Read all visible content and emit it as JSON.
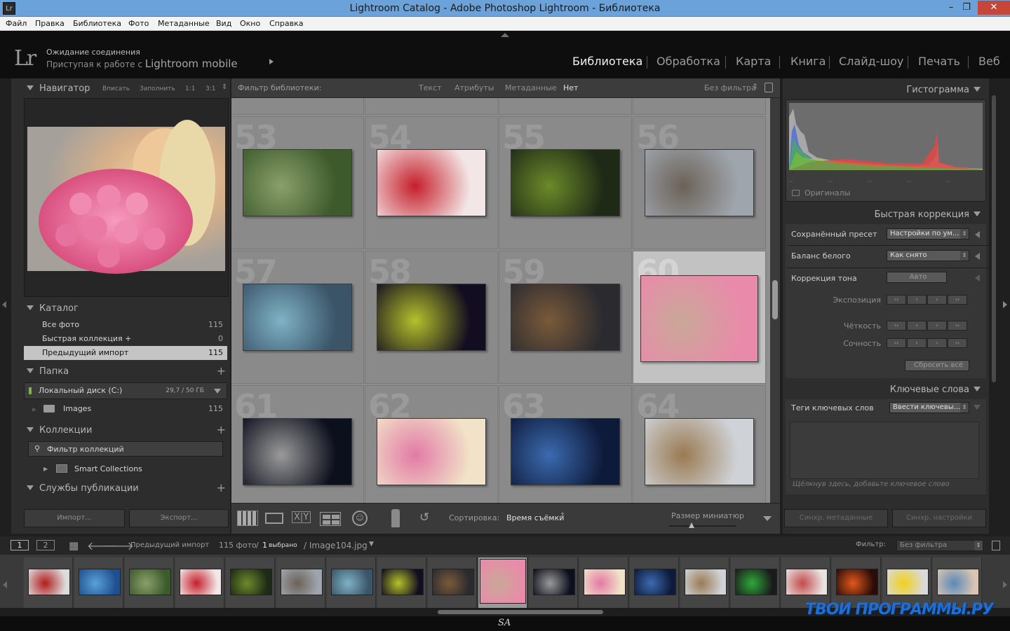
{
  "window": {
    "title": "Lightroom Catalog - Adobe Photoshop Lightroom - Библиотека",
    "app_icon": "Lr",
    "minimize": "–",
    "maximize": "❐",
    "close": "✕"
  },
  "menu": [
    "Файл",
    "Правка",
    "Библиотека",
    "Фото",
    "Метаданные",
    "Вид",
    "Окно",
    "Справка"
  ],
  "identity": {
    "logo": "Lr",
    "status_line1": "Ожидание соединения",
    "status_line2_prefix": "Приступая к работе с",
    "status_line2_brand": "Lightroom mobile"
  },
  "modules": [
    {
      "label": "Библиотека",
      "active": true
    },
    {
      "label": "Обработка",
      "active": false
    },
    {
      "label": "Карта",
      "active": false
    },
    {
      "label": "Книга",
      "active": false
    },
    {
      "label": "Слайд-шоу",
      "active": false
    },
    {
      "label": "Печать",
      "active": false
    },
    {
      "label": "Веб",
      "active": false
    }
  ],
  "navigator": {
    "title": "Навигатор",
    "options": [
      "Вписать",
      "Заполнить",
      "1:1",
      "3:1"
    ]
  },
  "catalog": {
    "title": "Каталог",
    "items": [
      {
        "label": "Все фото",
        "count": "115",
        "selected": false
      },
      {
        "label": "Быстрая коллекция +",
        "count": "0",
        "selected": false
      },
      {
        "label": "Предыдущий импорт",
        "count": "115",
        "selected": true
      }
    ]
  },
  "folders": {
    "title": "Папка",
    "disk_label": "Локальный диск (C:)",
    "disk_usage": "29,7 / 50 ГБ",
    "folder_label": "Images",
    "folder_count": "115"
  },
  "collections": {
    "title": "Коллекции",
    "filter_placeholder": "Фильтр коллекций",
    "smart": "Smart Collections"
  },
  "publish": {
    "title": "Службы публикации"
  },
  "left_buttons": {
    "import": "Импорт...",
    "export": "Экспорт..."
  },
  "filter_bar": {
    "label": "Фильтр библиотеки:",
    "tabs": [
      "Текст",
      "Атрибуты",
      "Метаданные",
      "Нет"
    ],
    "preset": "Без фильтра"
  },
  "grid": {
    "cells": [
      {
        "num": "53",
        "c1": "#3d5a2c",
        "c2": "#8aa06a",
        "selected": false
      },
      {
        "num": "54",
        "c1": "#f3e6e6",
        "c2": "#c51f2b",
        "selected": false
      },
      {
        "num": "55",
        "c1": "#1e2a16",
        "c2": "#6c8a2a",
        "selected": false
      },
      {
        "num": "56",
        "c1": "#9fa5ad",
        "c2": "#6b6258",
        "selected": false
      },
      {
        "num": "57",
        "c1": "#3b5468",
        "c2": "#7fb2c6",
        "selected": false
      },
      {
        "num": "58",
        "c1": "#120d20",
        "c2": "#b6c12a",
        "selected": false
      },
      {
        "num": "59",
        "c1": "#2a2a2f",
        "c2": "#7a5a3a",
        "selected": false
      },
      {
        "num": "60",
        "c1": "#e98aaa",
        "c2": "#caa898",
        "selected": true
      },
      {
        "num": "61",
        "c1": "#0c0f1c",
        "c2": "#9a9a9a",
        "selected": false
      },
      {
        "num": "62",
        "c1": "#f2e2c8",
        "c2": "#e27aa6",
        "selected": false
      },
      {
        "num": "63",
        "c1": "#0e1a3a",
        "c2": "#3b6bb0",
        "selected": false
      },
      {
        "num": "64",
        "c1": "#cfd3d8",
        "c2": "#9a7a52",
        "selected": false
      }
    ]
  },
  "toolbar": {
    "sort_label": "Сортировка:",
    "sort_value": "Время съёмки",
    "thumb_size_label": "Размер миниатюр"
  },
  "histogram": {
    "title": "Гистограмма",
    "originals": "Оригиналы"
  },
  "quick_develop": {
    "title": "Быстрая коррекция",
    "saved_preset_label": "Сохранённый пресет",
    "saved_preset_value": "Настройки по ум...",
    "wb_label": "Баланс белого",
    "wb_value": "Как снято",
    "tone_label": "Коррекция тона",
    "auto_btn": "Авто",
    "exposure": "Экспозиция",
    "clarity": "Чёткость",
    "vibrance": "Сочность",
    "reset": "Сбросить всё"
  },
  "keywords": {
    "title": "Ключевые слова",
    "tags_label": "Теги ключевых слов",
    "tags_value": "Ввести ключевы...",
    "hint": "Щёлкнув здесь, добавьте ключевое слово"
  },
  "right_buttons": {
    "sync_meta": "Синхр. метаданные",
    "sync_settings": "Синхр. настройки"
  },
  "filmstrip": {
    "screen1": "1",
    "screen2": "2",
    "source": "Предыдущий импорт",
    "count_text": "115 фото",
    "selected_count": "1",
    "selected_label": "выбрано",
    "filename": "/ Image104.jpg",
    "filter_label": "Фильтр:",
    "filter_value": "Без фильтра",
    "thumbs": [
      {
        "c1": "#dcdcdc",
        "c2": "#b21c1c",
        "sel": false
      },
      {
        "c1": "#1e4f8e",
        "c2": "#5ba0d8",
        "sel": false
      },
      {
        "c1": "#3d5a2c",
        "c2": "#8aa06a",
        "sel": false
      },
      {
        "c1": "#f3e6e6",
        "c2": "#c51f2b",
        "sel": false
      },
      {
        "c1": "#1e2a16",
        "c2": "#6c8a2a",
        "sel": false
      },
      {
        "c1": "#9fa5ad",
        "c2": "#6b6258",
        "sel": false
      },
      {
        "c1": "#3b5468",
        "c2": "#7fb2c6",
        "sel": false
      },
      {
        "c1": "#120d20",
        "c2": "#b6c12a",
        "sel": false
      },
      {
        "c1": "#2a2a2f",
        "c2": "#7a5a3a",
        "sel": false
      },
      {
        "c1": "#e98aaa",
        "c2": "#caa898",
        "sel": true
      },
      {
        "c1": "#0c0f1c",
        "c2": "#9a9a9a",
        "sel": false
      },
      {
        "c1": "#f2e2c8",
        "c2": "#e27aa6",
        "sel": false
      },
      {
        "c1": "#0e1a3a",
        "c2": "#3b6bb0",
        "sel": false
      },
      {
        "c1": "#cfd3d8",
        "c2": "#9a7a52",
        "sel": false
      },
      {
        "c1": "#1a1a1a",
        "c2": "#2fa83a",
        "sel": false
      },
      {
        "c1": "#e8e2e0",
        "c2": "#c44a4a",
        "sel": false
      },
      {
        "c1": "#2a0c08",
        "c2": "#e2581c",
        "sel": false
      },
      {
        "c1": "#d9d9d9",
        "c2": "#f0d21a",
        "sel": false
      },
      {
        "c1": "#d8c4b2",
        "c2": "#5a8ab8",
        "sel": false
      }
    ]
  },
  "bottom_mark": "SA",
  "watermark": "ТВОИ ПРОГРАММЫ.РУ"
}
